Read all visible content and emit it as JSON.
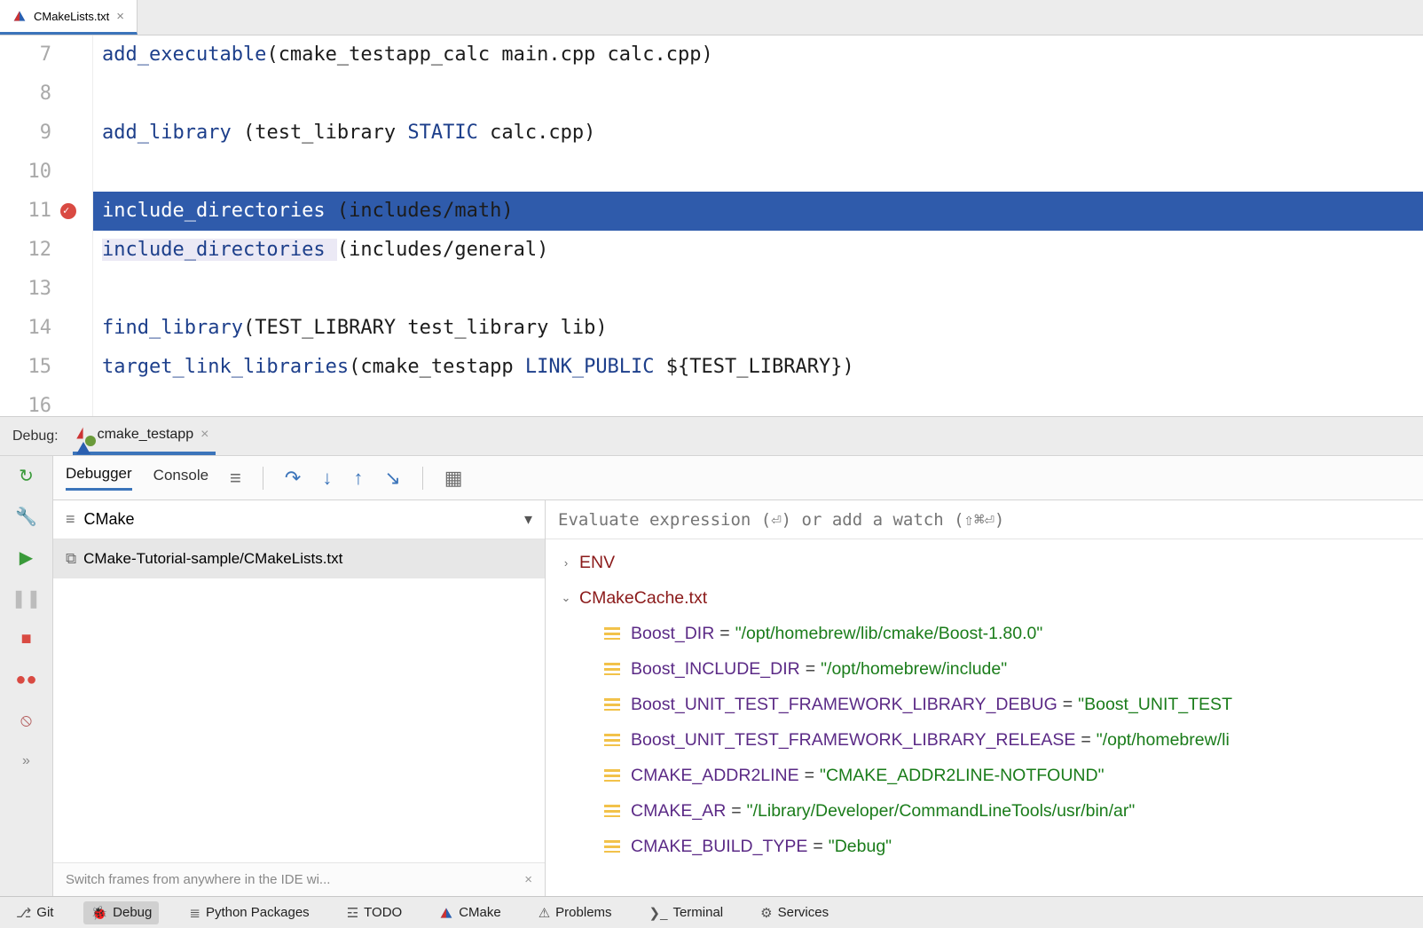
{
  "file_tab": {
    "name": "CMakeLists.txt"
  },
  "editor": {
    "lines": [
      {
        "n": 7,
        "tokens": [
          [
            "fn",
            "add_executable"
          ],
          [
            "paren",
            "("
          ],
          [
            "txt",
            "cmake_testapp_calc main.cpp calc.cpp"
          ],
          [
            "paren",
            ")"
          ]
        ]
      },
      {
        "n": 8,
        "tokens": []
      },
      {
        "n": 9,
        "tokens": [
          [
            "fn",
            "add_library "
          ],
          [
            "paren",
            "("
          ],
          [
            "txt",
            "test_library "
          ],
          [
            "kw",
            "STATIC"
          ],
          [
            "txt",
            " calc.cpp"
          ],
          [
            "paren",
            ")"
          ]
        ]
      },
      {
        "n": 10,
        "tokens": []
      },
      {
        "n": 11,
        "breakpoint": true,
        "selected": true,
        "tokens": [
          [
            "fn",
            "include_directories "
          ],
          [
            "paren",
            "("
          ],
          [
            "txt",
            "includes/math"
          ],
          [
            "paren",
            ")"
          ]
        ]
      },
      {
        "n": 12,
        "pale": true,
        "tokens": [
          [
            "fn",
            "include_directories "
          ],
          [
            "paren",
            "("
          ],
          [
            "txt",
            "includes/general"
          ],
          [
            "paren",
            ")"
          ]
        ]
      },
      {
        "n": 13,
        "tokens": []
      },
      {
        "n": 14,
        "tokens": [
          [
            "fn",
            "find_library"
          ],
          [
            "paren",
            "("
          ],
          [
            "txt",
            "TEST_LIBRARY test_library lib"
          ],
          [
            "paren",
            ")"
          ]
        ]
      },
      {
        "n": 15,
        "tokens": [
          [
            "fn",
            "target_link_libraries"
          ],
          [
            "paren",
            "("
          ],
          [
            "txt",
            "cmake_testapp "
          ],
          [
            "kw",
            "LINK_PUBLIC"
          ],
          [
            "txt",
            " ${TEST_LIBRARY}"
          ],
          [
            "paren",
            ")"
          ]
        ]
      },
      {
        "n": 16,
        "tokens": []
      }
    ]
  },
  "debug": {
    "label": "Debug:",
    "run_config": "cmake_testapp",
    "tabs": {
      "debugger": "Debugger",
      "console": "Console"
    },
    "frames": {
      "dropdown": "CMake",
      "current": "CMake-Tutorial-sample/CMakeLists.txt",
      "tip": "Switch frames from anywhere in the IDE wi..."
    },
    "watch_placeholder": "Evaluate expression (⏎) or add a watch (⇧⌘⏎)",
    "tree": {
      "env": "ENV",
      "cache": "CMakeCache.txt",
      "vars": [
        {
          "name": "Boost_DIR",
          "val": "\"/opt/homebrew/lib/cmake/Boost-1.80.0\""
        },
        {
          "name": "Boost_INCLUDE_DIR",
          "val": "\"/opt/homebrew/include\""
        },
        {
          "name": "Boost_UNIT_TEST_FRAMEWORK_LIBRARY_DEBUG",
          "val": "\"Boost_UNIT_TEST"
        },
        {
          "name": "Boost_UNIT_TEST_FRAMEWORK_LIBRARY_RELEASE",
          "val": "\"/opt/homebrew/li"
        },
        {
          "name": "CMAKE_ADDR2LINE",
          "val": "\"CMAKE_ADDR2LINE-NOTFOUND\""
        },
        {
          "name": "CMAKE_AR",
          "val": "\"/Library/Developer/CommandLineTools/usr/bin/ar\""
        },
        {
          "name": "CMAKE_BUILD_TYPE",
          "val": "\"Debug\""
        }
      ]
    }
  },
  "bottom": {
    "git": "Git",
    "debug": "Debug",
    "python": "Python Packages",
    "todo": "TODO",
    "cmake": "CMake",
    "problems": "Problems",
    "terminal": "Terminal",
    "services": "Services"
  }
}
